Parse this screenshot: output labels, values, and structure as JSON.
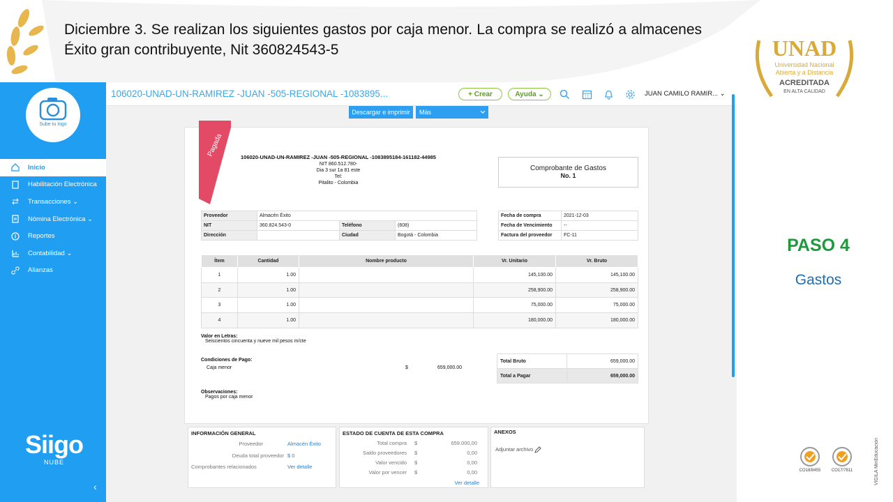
{
  "slide": {
    "title": "Diciembre 3. Se realizan los siguientes gastos por caja menor. La compra se realizó a almacenes Éxito gran contribuyente, Nit 360824543-5",
    "step": "PASO 4",
    "step_subtitle": "Gastos",
    "logo": {
      "name": "UNAD",
      "line1": "Universidad Nacional",
      "line2": "Abierta y a Distancia",
      "line3": "ACREDITADA",
      "line4": "EN ALTA CALIDAD"
    },
    "certs": [
      {
        "code": "CO18/8455"
      },
      {
        "code": "CO17/7811"
      }
    ],
    "vertical_text": "VIGILA MinEducación",
    "colors": {
      "step": "#1c9a3c",
      "subtitle": "#1a6fb5",
      "gold": "#d9a93a"
    }
  },
  "app": {
    "sidebar": {
      "avatar_label": "Sube tu logo",
      "items": [
        {
          "label": "Inicio",
          "icon": "home-icon"
        },
        {
          "label": "Habilitación Electrónica",
          "icon": "document-icon"
        },
        {
          "label": "Transacciones ⌄",
          "icon": "transactions-icon"
        },
        {
          "label": "Nómina Electrónica ⌄",
          "icon": "payroll-icon"
        },
        {
          "label": "Reportes",
          "icon": "reports-icon"
        },
        {
          "label": "Contabilidad ⌄",
          "icon": "accounting-icon"
        },
        {
          "label": "Alianzas",
          "icon": "link-icon"
        }
      ],
      "brand": "Siigo",
      "brand_sub": "NUBE",
      "collapse": "‹"
    },
    "topbar": {
      "company": "106020-UNAD-UN-RAMIREZ -JUAN -505-REGIONAL -1083895...",
      "create": "+ Crear",
      "help": "Ayuda ⌄",
      "user": "JUAN CAMILO RAMIR... ⌄"
    },
    "actions": {
      "download": "Descargar e imprimir",
      "more": "Más"
    },
    "doc": {
      "ribbon": "Pagada",
      "emitter": {
        "name": "106020-UNAD-UN-RAMIREZ -JUAN -505-REGIONAL -1083895184-161182-44985",
        "nit": "NIT 860.512.780-",
        "address": "Dia 3 sur 1a 81 este",
        "tel": "Tel:",
        "city": "Pitalito - Colombia"
      },
      "voucher_title": "Comprobante de Gastos",
      "voucher_no": "No. 1",
      "provider": {
        "l_proveedor": "Proveedor",
        "v_proveedor": "Almacén Éxito",
        "l_nit": "NIT",
        "v_nit": "360.824.543-0",
        "l_telefono": "Teléfono",
        "v_telefono": "(608)",
        "l_direccion": "Dirección",
        "v_direccion": "",
        "l_ciudad": "Ciudad",
        "v_ciudad": "Bogotá - Colombia"
      },
      "dates": {
        "l_compra": "Fecha de compra",
        "v_compra": "2021-12-03",
        "l_venc": "Fecha de Vencimiento",
        "v_venc": "--",
        "l_factura": "Factura del proveedor",
        "v_factura": "FC-11"
      },
      "items_headers": [
        "Ítem",
        "Cantidad",
        "Nombre producto",
        "Vr. Unitario",
        "Vr. Bruto"
      ],
      "items": [
        [
          "1",
          "1.00",
          "",
          "145,100.00",
          "145,100.00"
        ],
        [
          "2",
          "1.00",
          "",
          "258,900.00",
          "258,900.00"
        ],
        [
          "3",
          "1.00",
          "",
          "75,000.00",
          "75,000.00"
        ],
        [
          "4",
          "1.00",
          "",
          "180,000.00",
          "180,000.00"
        ]
      ],
      "valor_letras_label": "Valor en Letras:",
      "valor_letras": "Seiscientos cincuenta y nueve mil pesos m/cte",
      "condiciones_label": "Condiciones de Pago:",
      "condicion": "Caja menor",
      "condicion_currency": "$",
      "condicion_value": "659,000.00",
      "observaciones_label": "Observaciones:",
      "observaciones": "Pagos por caja menor",
      "total_bruto_label": "Total Bruto",
      "total_bruto": "659,000.00",
      "total_pagar_label": "Total a Pagar",
      "total_pagar": "659,000.00"
    },
    "info": {
      "title": "INFORMACIÓN GENERAL",
      "l1": "Proveedor",
      "v1": "Almacén Éxito",
      "l2": "Deuda total proveedor",
      "v2": "$ 0",
      "l3": "Comprobantes relacionados",
      "v3": "Ver detalle"
    },
    "estado": {
      "title": "ESTADO DE CUENTA DE ESTA COMPRA",
      "rows": [
        {
          "label": "Total compra",
          "cur": "$",
          "value": "659.000,00"
        },
        {
          "label": "Saldo proveedores",
          "cur": "$",
          "value": "0,00"
        },
        {
          "label": "Valor vencido",
          "cur": "$",
          "value": "0,00"
        },
        {
          "label": "Valor por vencer",
          "cur": "$",
          "value": "0,00"
        }
      ],
      "link": "Ver detalle"
    },
    "anexos": {
      "title": "ANEXOS",
      "attach": "Adjuntar archivo"
    }
  }
}
